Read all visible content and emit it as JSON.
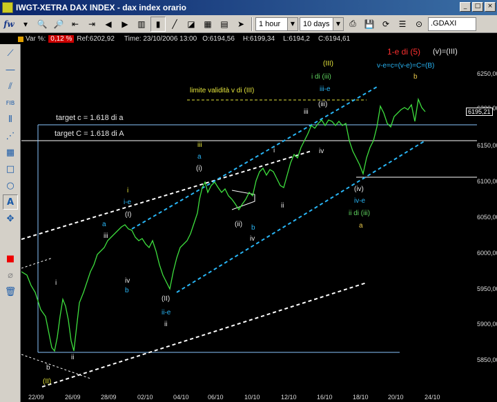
{
  "window": {
    "title": "IWGT-XETRA DAX INDEX  -  dax index orario",
    "min_label": "_",
    "max_label": "□",
    "close_label": "×"
  },
  "toolbar": {
    "fw_label": "fw",
    "interval": "1 hour",
    "range": "10 days",
    "symbol": ".GDAXI"
  },
  "infobar": {
    "var_label": "Var %:",
    "var_value": "0,12 %",
    "ref": "Ref:6202,92",
    "time": "Time:  23/10/2006 13:00",
    "open": "O:6194,56",
    "high": "H:6199,34",
    "low": "L:6194,2",
    "close": "C:6194,61"
  },
  "chart": {
    "current_price": "6195,21",
    "price_axis": [
      "6250,00",
      "6200,00",
      "6150,00",
      "6100,00",
      "6050,00",
      "6000,00",
      "5950,00",
      "5900,00",
      "5850,00"
    ],
    "date_axis": [
      "22/09",
      "26/09",
      "28/09",
      "02/10",
      "04/10",
      "06/10",
      "10/10",
      "12/10",
      "16/10",
      "18/10",
      "20/10",
      "24/10"
    ],
    "labels": {
      "wave_title": "1-e di (5)",
      "wave_title2": "(v)=(III)",
      "formula": "v-e=c=(v-e)=C=(B)",
      "b_top": "b",
      "limit": "limite validità v di (III)",
      "target_c": "target c = 1.618 di a",
      "target_C": "target C = 1.618 di A",
      "III_top": "(III)",
      "i_di_iii": "i di (iii)",
      "iii_e": "iii-e",
      "iii_paren": "(iii)",
      "iii_small": "iii",
      "iv_small": "iv",
      "iii_left": "iii",
      "a_left": "a",
      "i_paren_left": "(i)",
      "i_small": "i",
      "i_e": "i-e",
      "I_paren": "(I)",
      "a_first": "a",
      "iii_first": "iii",
      "iv_first": "iv",
      "b_first": "b",
      "II_paren": "(II)",
      "ii_e": "ii-e",
      "ii_first": "ii",
      "ii_paren_mid": "(ii)",
      "b_mid": "b",
      "iv_mid": "iv",
      "i_mid": "i",
      "ii_mid": "ii",
      "iv_paren": "(iv)",
      "iv_e": "iv-e",
      "ii_di_iii": "ii di (iii)",
      "a_lower": "a",
      "i_start": "i",
      "ii_start": "ii",
      "b_start": "b",
      "II_bottom": "(II)"
    }
  }
}
